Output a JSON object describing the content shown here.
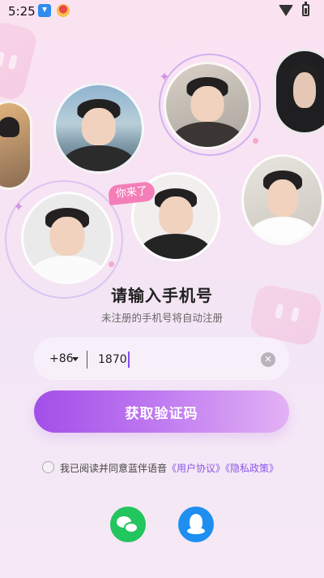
{
  "status_bar": {
    "time": "5:25",
    "icons": [
      "download-icon",
      "app-notification-icon",
      "wifi-icon",
      "battery-icon"
    ]
  },
  "decorations": {
    "tag_text": "你来了",
    "colors": {
      "accent_purple": "#a24ee8",
      "tag_pink": "#f47fb8",
      "link_purple": "#8b58e8",
      "wechat_green": "#22c55e",
      "qq_blue": "#1e8ff0"
    }
  },
  "login": {
    "title": "请输入手机号",
    "subtitle": "未注册的手机号将自动注册",
    "country_code": "+86",
    "phone_value": "1870",
    "submit_label": "获取验证码"
  },
  "agreement": {
    "checked": false,
    "prefix": "我已阅读并同意蓝伴语音",
    "user_agreement": "《用户协议》",
    "privacy_policy": "《隐私政策》"
  },
  "social_login": [
    {
      "name": "wechat",
      "icon": "wechat-icon"
    },
    {
      "name": "qq",
      "icon": "qq-icon"
    }
  ]
}
